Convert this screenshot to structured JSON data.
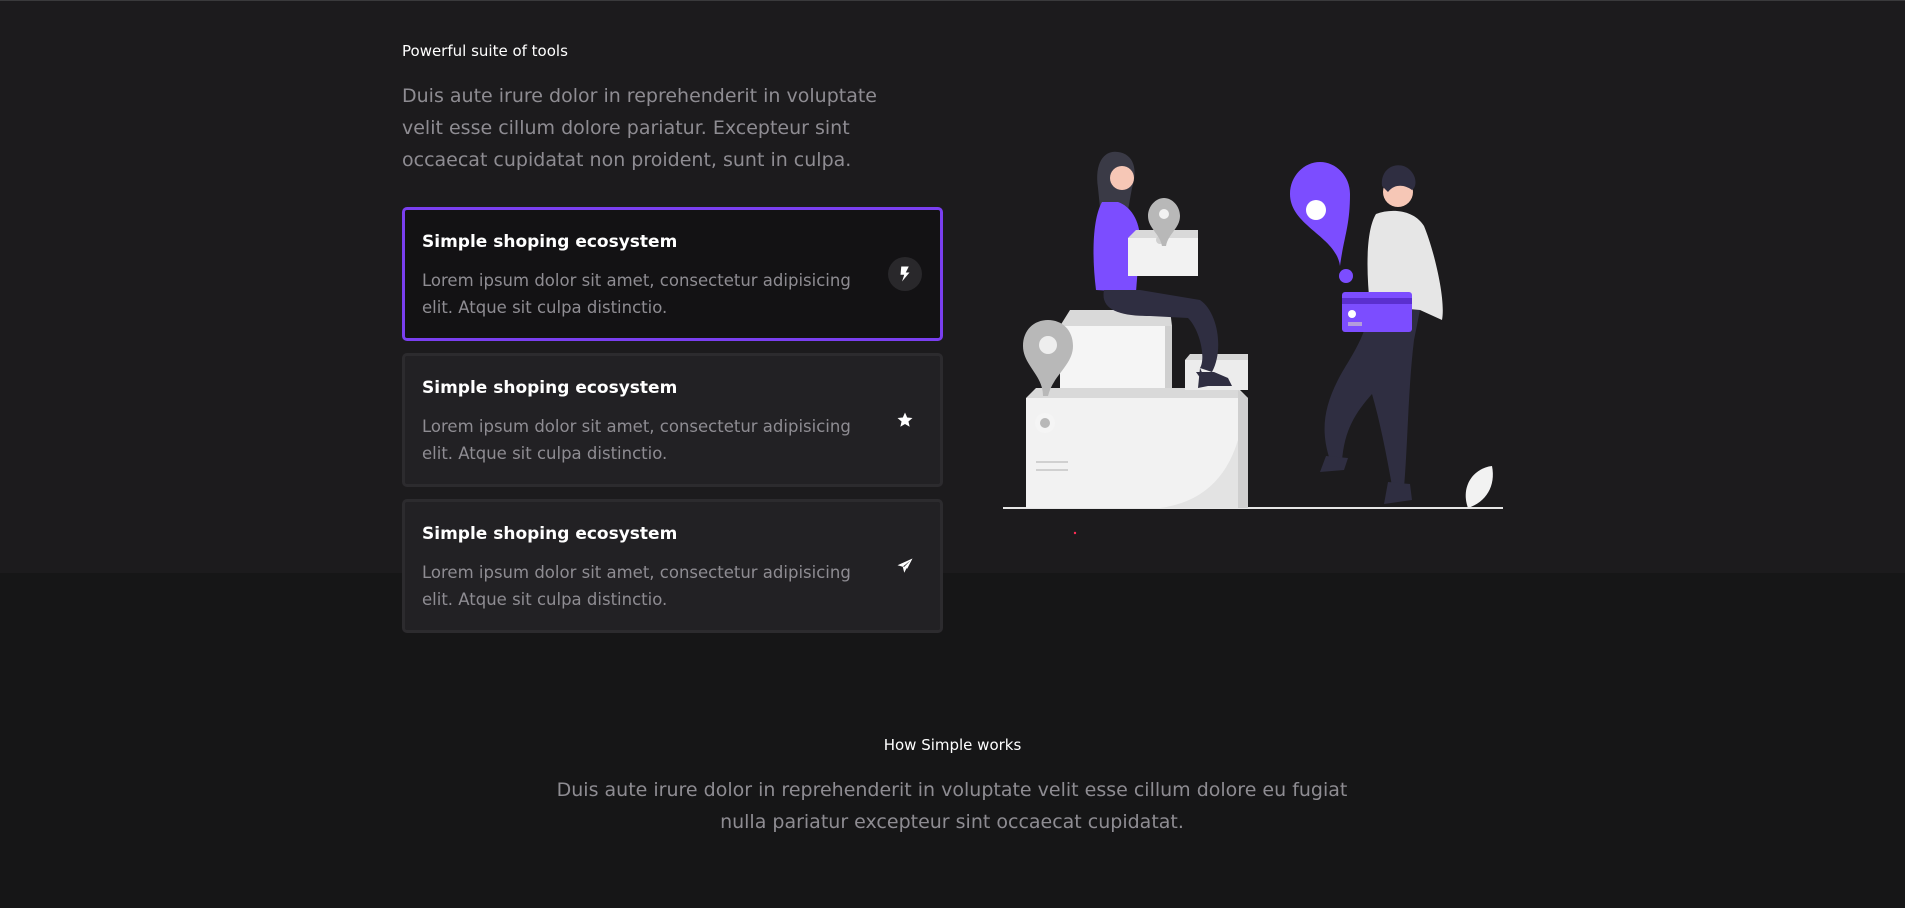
{
  "features": {
    "eyebrow": "Powerful suite of tools",
    "lead": "Duis aute irure dolor in reprehenderit in voluptate velit esse cillum dolore pariatur. Excepteur sint occaecat cupidatat non proident, sunt in culpa.",
    "cards": [
      {
        "title": "Simple shoping ecosystem",
        "text": "Lorem ipsum dolor sit amet, consectetur adipisicing elit. Atque sit culpa distinctio.",
        "icon": "lightning-icon",
        "active": true
      },
      {
        "title": "Simple shoping ecosystem",
        "text": "Lorem ipsum dolor sit amet, consectetur adipisicing elit. Atque sit culpa distinctio.",
        "icon": "star-icon",
        "active": false
      },
      {
        "title": "Simple shoping ecosystem",
        "text": "Lorem ipsum dolor sit amet, consectetur adipisicing elit. Atque sit culpa distinctio.",
        "icon": "paper-plane-icon",
        "active": false
      }
    ]
  },
  "how": {
    "eyebrow": "How Simple works",
    "lead": "Duis aute irure dolor in reprehenderit in voluptate velit esse cillum dolore eu fugiat nulla pariatur excepteur sint occaecat cupidatat."
  },
  "colors": {
    "accent": "#7a3ff0",
    "background_top": "#1c1b1d",
    "background_bottom": "#161617",
    "muted_text": "#8e8c92"
  }
}
